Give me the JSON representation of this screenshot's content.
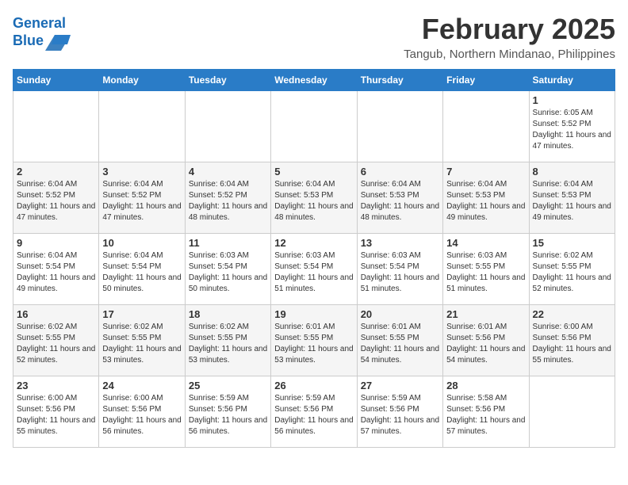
{
  "logo": {
    "line1": "General",
    "line2": "Blue"
  },
  "title": "February 2025",
  "subtitle": "Tangub, Northern Mindanao, Philippines",
  "days_of_week": [
    "Sunday",
    "Monday",
    "Tuesday",
    "Wednesday",
    "Thursday",
    "Friday",
    "Saturday"
  ],
  "weeks": [
    [
      {
        "day": "",
        "info": ""
      },
      {
        "day": "",
        "info": ""
      },
      {
        "day": "",
        "info": ""
      },
      {
        "day": "",
        "info": ""
      },
      {
        "day": "",
        "info": ""
      },
      {
        "day": "",
        "info": ""
      },
      {
        "day": "1",
        "info": "Sunrise: 6:05 AM\nSunset: 5:52 PM\nDaylight: 11 hours and 47 minutes."
      }
    ],
    [
      {
        "day": "2",
        "info": "Sunrise: 6:04 AM\nSunset: 5:52 PM\nDaylight: 11 hours and 47 minutes."
      },
      {
        "day": "3",
        "info": "Sunrise: 6:04 AM\nSunset: 5:52 PM\nDaylight: 11 hours and 47 minutes."
      },
      {
        "day": "4",
        "info": "Sunrise: 6:04 AM\nSunset: 5:52 PM\nDaylight: 11 hours and 48 minutes."
      },
      {
        "day": "5",
        "info": "Sunrise: 6:04 AM\nSunset: 5:53 PM\nDaylight: 11 hours and 48 minutes."
      },
      {
        "day": "6",
        "info": "Sunrise: 6:04 AM\nSunset: 5:53 PM\nDaylight: 11 hours and 48 minutes."
      },
      {
        "day": "7",
        "info": "Sunrise: 6:04 AM\nSunset: 5:53 PM\nDaylight: 11 hours and 49 minutes."
      },
      {
        "day": "8",
        "info": "Sunrise: 6:04 AM\nSunset: 5:53 PM\nDaylight: 11 hours and 49 minutes."
      }
    ],
    [
      {
        "day": "9",
        "info": "Sunrise: 6:04 AM\nSunset: 5:54 PM\nDaylight: 11 hours and 49 minutes."
      },
      {
        "day": "10",
        "info": "Sunrise: 6:04 AM\nSunset: 5:54 PM\nDaylight: 11 hours and 50 minutes."
      },
      {
        "day": "11",
        "info": "Sunrise: 6:03 AM\nSunset: 5:54 PM\nDaylight: 11 hours and 50 minutes."
      },
      {
        "day": "12",
        "info": "Sunrise: 6:03 AM\nSunset: 5:54 PM\nDaylight: 11 hours and 51 minutes."
      },
      {
        "day": "13",
        "info": "Sunrise: 6:03 AM\nSunset: 5:54 PM\nDaylight: 11 hours and 51 minutes."
      },
      {
        "day": "14",
        "info": "Sunrise: 6:03 AM\nSunset: 5:55 PM\nDaylight: 11 hours and 51 minutes."
      },
      {
        "day": "15",
        "info": "Sunrise: 6:02 AM\nSunset: 5:55 PM\nDaylight: 11 hours and 52 minutes."
      }
    ],
    [
      {
        "day": "16",
        "info": "Sunrise: 6:02 AM\nSunset: 5:55 PM\nDaylight: 11 hours and 52 minutes."
      },
      {
        "day": "17",
        "info": "Sunrise: 6:02 AM\nSunset: 5:55 PM\nDaylight: 11 hours and 53 minutes."
      },
      {
        "day": "18",
        "info": "Sunrise: 6:02 AM\nSunset: 5:55 PM\nDaylight: 11 hours and 53 minutes."
      },
      {
        "day": "19",
        "info": "Sunrise: 6:01 AM\nSunset: 5:55 PM\nDaylight: 11 hours and 53 minutes."
      },
      {
        "day": "20",
        "info": "Sunrise: 6:01 AM\nSunset: 5:55 PM\nDaylight: 11 hours and 54 minutes."
      },
      {
        "day": "21",
        "info": "Sunrise: 6:01 AM\nSunset: 5:56 PM\nDaylight: 11 hours and 54 minutes."
      },
      {
        "day": "22",
        "info": "Sunrise: 6:00 AM\nSunset: 5:56 PM\nDaylight: 11 hours and 55 minutes."
      }
    ],
    [
      {
        "day": "23",
        "info": "Sunrise: 6:00 AM\nSunset: 5:56 PM\nDaylight: 11 hours and 55 minutes."
      },
      {
        "day": "24",
        "info": "Sunrise: 6:00 AM\nSunset: 5:56 PM\nDaylight: 11 hours and 56 minutes."
      },
      {
        "day": "25",
        "info": "Sunrise: 5:59 AM\nSunset: 5:56 PM\nDaylight: 11 hours and 56 minutes."
      },
      {
        "day": "26",
        "info": "Sunrise: 5:59 AM\nSunset: 5:56 PM\nDaylight: 11 hours and 56 minutes."
      },
      {
        "day": "27",
        "info": "Sunrise: 5:59 AM\nSunset: 5:56 PM\nDaylight: 11 hours and 57 minutes."
      },
      {
        "day": "28",
        "info": "Sunrise: 5:58 AM\nSunset: 5:56 PM\nDaylight: 11 hours and 57 minutes."
      },
      {
        "day": "",
        "info": ""
      }
    ]
  ]
}
